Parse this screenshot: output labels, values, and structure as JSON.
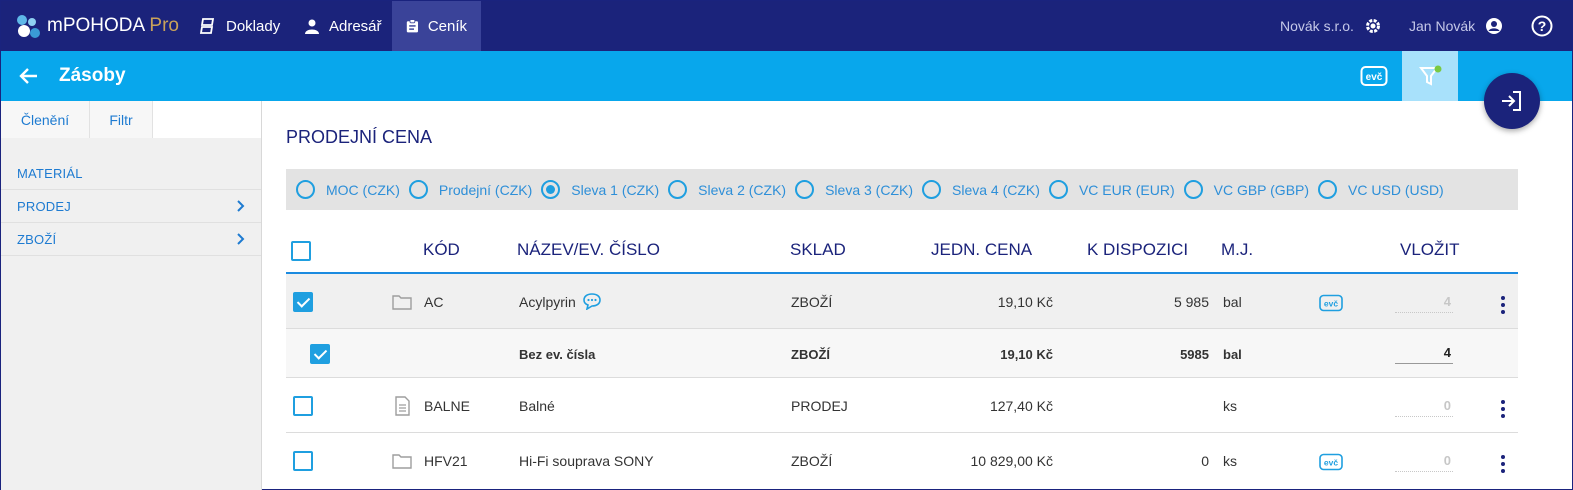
{
  "app": {
    "brand": "mPOHODA",
    "brand_suffix": "Pro"
  },
  "nav": [
    {
      "label": "Doklady",
      "icon": "documents-icon"
    },
    {
      "label": "Adresář",
      "icon": "person-icon"
    },
    {
      "label": "Ceník",
      "icon": "clipboard-icon",
      "active": true
    }
  ],
  "top_right": {
    "company": "Novák s.r.o.",
    "user": "Jan Novák"
  },
  "subbar": {
    "title": "Zásoby",
    "evc_label": "evč"
  },
  "sidebar": {
    "tabs": [
      "Členění",
      "Filtr"
    ],
    "items": [
      {
        "label": "MATERIÁL",
        "has_chevron": false
      },
      {
        "label": "PRODEJ",
        "has_chevron": true
      },
      {
        "label": "ZBOŽÍ",
        "has_chevron": true
      }
    ]
  },
  "main": {
    "section_title": "PRODEJNÍ CENA",
    "price_options": [
      {
        "label": "MOC (CZK)",
        "selected": false
      },
      {
        "label": "Prodejní (CZK)",
        "selected": false
      },
      {
        "label": "Sleva 1 (CZK)",
        "selected": true
      },
      {
        "label": "Sleva 2 (CZK)",
        "selected": false
      },
      {
        "label": "Sleva 3 (CZK)",
        "selected": false
      },
      {
        "label": "Sleva 4 (CZK)",
        "selected": false
      },
      {
        "label": "VC EUR (EUR)",
        "selected": false
      },
      {
        "label": "VC GBP (GBP)",
        "selected": false
      },
      {
        "label": "VC USD (USD)",
        "selected": false
      }
    ],
    "columns": {
      "code": "KÓD",
      "name": "NÁZEV/EV. ČÍSLO",
      "store": "SKLAD",
      "unit_price": "JEDN. CENA",
      "available": "K DISPOZICI",
      "unit": "M.J.",
      "insert": "VLOŽIT"
    },
    "rows": [
      {
        "code": "AC",
        "name": "Acylpyrin",
        "store": "ZBOŽÍ",
        "price": "19,10 Kč",
        "available": "5 985",
        "unit": "bal",
        "qty": "4",
        "evc": "evč",
        "checked": true
      },
      {
        "name": "Bez ev. čísla",
        "store": "ZBOŽÍ",
        "price": "19,10 Kč",
        "available": "5985",
        "unit": "bal",
        "qty": "4",
        "checked": true
      },
      {
        "code": "BALNE",
        "name": "Balné",
        "store": "PRODEJ",
        "price": "127,40 Kč",
        "available": "",
        "unit": "ks",
        "qty": "0",
        "checked": false
      },
      {
        "code": "HFV21",
        "name": "Hi-Fi souprava SONY",
        "store": "ZBOŽÍ",
        "price": "10 829,00 Kč",
        "available": "0",
        "unit": "ks",
        "qty": "0",
        "evc": "evč",
        "checked": false
      }
    ]
  },
  "colors": {
    "navy": "#1b237b",
    "blue": "#08a7ec",
    "accent": "#1f9fe0"
  }
}
